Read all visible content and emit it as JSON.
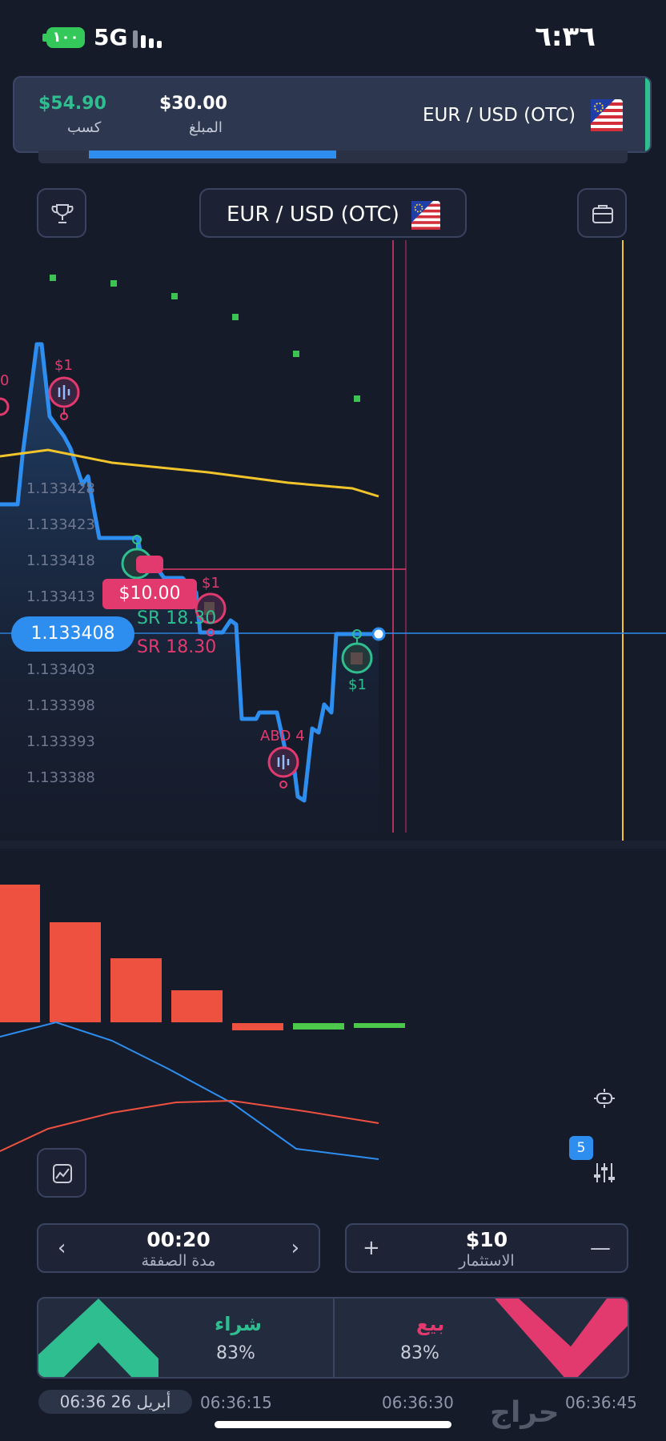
{
  "status_bar": {
    "battery": "١٠٠",
    "network": "5G",
    "time": "٦:٣٦"
  },
  "trade_card": {
    "profit": "$54.90",
    "profit_label": "كسب",
    "amount": "$30.00",
    "amount_label": "المبلغ",
    "pair": "EUR / USD (OTC)",
    "progress": 0.42
  },
  "asset_selector": {
    "pair": "EUR / USD (OTC)"
  },
  "chart": {
    "price_ticks": [
      "1.133428",
      "1.133423",
      "1.133418",
      "1.133413",
      "1.133403",
      "1.133398",
      "1.133393",
      "1.133388"
    ],
    "current_price": "1.133408",
    "bet_tag": "$10.00",
    "sr_green": "SR 18.30",
    "sr_red": "SR 18.30",
    "marker_labels": {
      "left_partial": "0",
      "m1": "$1",
      "m2": "$1",
      "m3": "ABD 4",
      "m4": "$1"
    }
  },
  "indicators": {
    "count_badge": "5"
  },
  "duration": {
    "value": "00:20",
    "label": "مدة الصفقة",
    "prev": "‹",
    "next": "›"
  },
  "investment": {
    "value": "$10",
    "label": "الاستثمار",
    "plus": "+",
    "minus": "—"
  },
  "buy": {
    "label": "شراء",
    "payout": "83%"
  },
  "sell": {
    "label": "بيع",
    "payout": "83%"
  },
  "time_axis": {
    "date": "06:36 26 أبريل",
    "t1": "06:36:15",
    "t2": "06:36:30",
    "t3": "06:36:45"
  },
  "watermark": "حراج",
  "colors": {
    "accent": "#2d8ef0",
    "buy": "#2fbe8f",
    "sell": "#e23a6e",
    "background": "#161b2a"
  }
}
